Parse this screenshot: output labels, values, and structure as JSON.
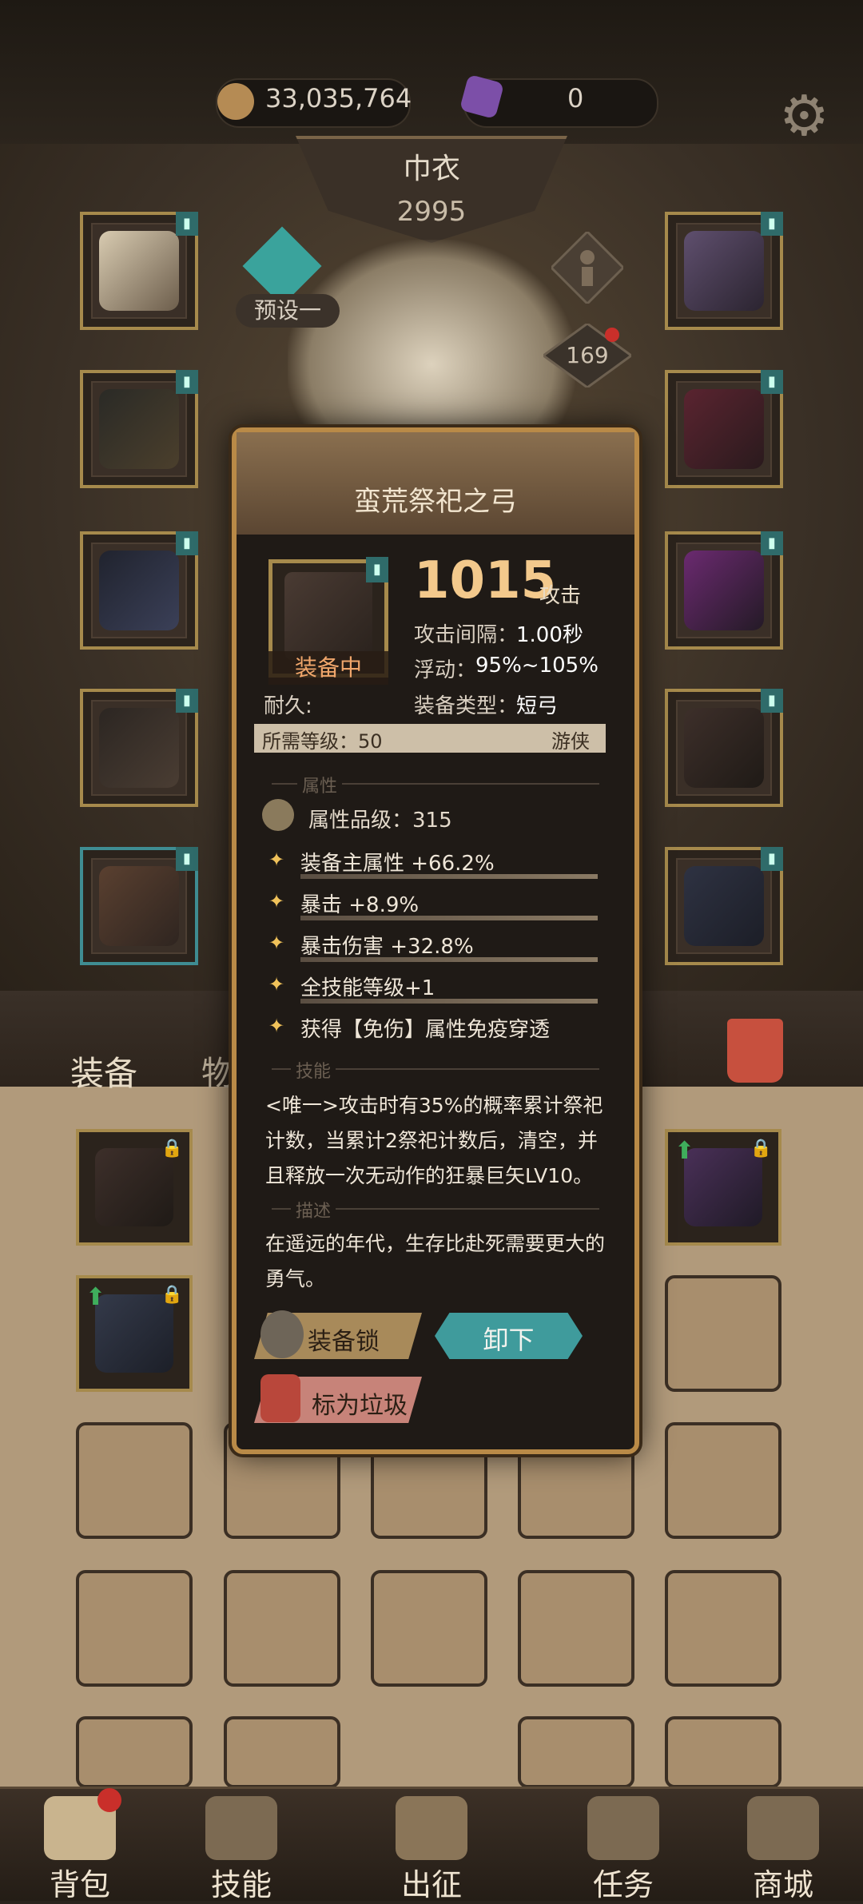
{
  "resources": {
    "gold": "33,035,764",
    "gems": "0",
    "gold_color": "#b58b54",
    "gem_color": "#7c4fa8"
  },
  "header": {
    "slot_name": "巾衣",
    "power": "2995"
  },
  "preset": {
    "label": "预设一"
  },
  "level_badge": "169",
  "tabs": {
    "equip": "装备",
    "items": "物品"
  },
  "popup": {
    "title": "蛮荒祭祀之弓",
    "equipped_label": "装备中",
    "attack_value": "1015",
    "attack_unit": "攻击",
    "interval_label": "攻击间隔：",
    "interval_value": "1.00秒",
    "float_label": "浮动：",
    "float_value": "95%~105%",
    "durability_label": "耐久:",
    "type_label": "装备类型：",
    "type_value": "短弓",
    "level_req": "所需等级：50",
    "class": "游侠",
    "section_attr": "属性",
    "quality": "属性品级：315",
    "attributes": [
      "装备主属性 +66.2%",
      "暴击 +8.9%",
      "暴击伤害 +32.8%",
      "全技能等级+1",
      "获得【免伤】属性免疫穿透"
    ],
    "section_skill": "技能",
    "skill_text": "<唯一>攻击时有35%的概率累计祭祀计数，当累计2祭祀计数后，清空，并且释放一次无动作的狂暴巨矢LV10。",
    "section_desc": "描述",
    "desc_text": "在遥远的年代，生存比赴死需要更大的勇气。",
    "lock_button": "装备锁",
    "unequip_button": "卸下",
    "junk_button": "标为垃圾"
  },
  "nav": [
    "背包",
    "技能",
    "出征",
    "任务",
    "商城"
  ]
}
